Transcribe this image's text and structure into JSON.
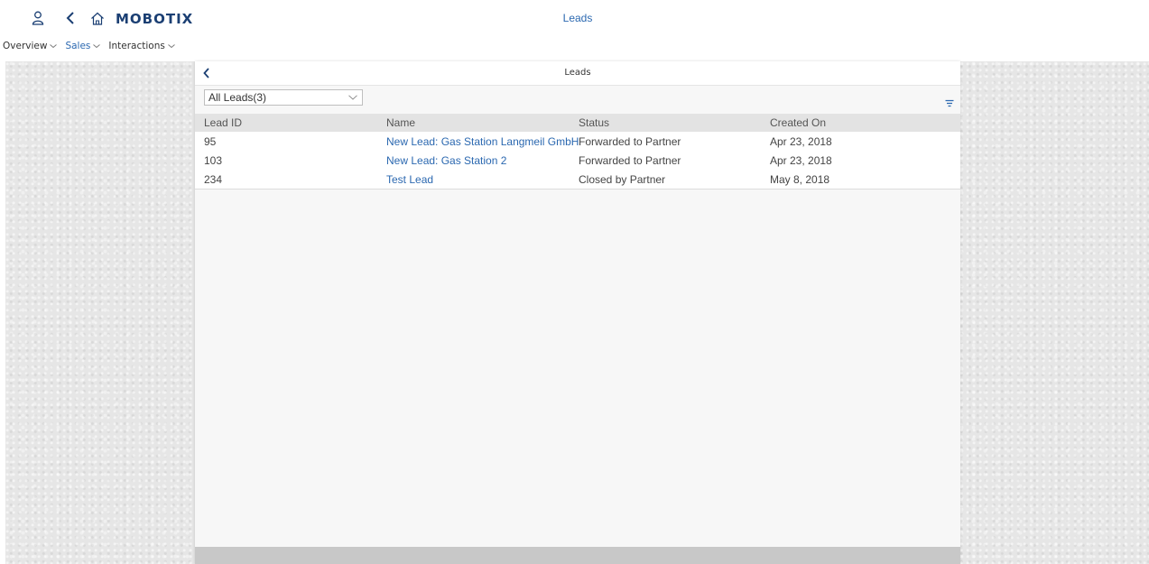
{
  "shell": {
    "brand": "MOBOTIX",
    "title": "Leads"
  },
  "nav": {
    "items": [
      {
        "label": "Overview"
      },
      {
        "label": "Sales"
      },
      {
        "label": "Interactions"
      }
    ],
    "active": "Sales"
  },
  "panel": {
    "title": "Leads",
    "filter_select": {
      "value": "All Leads(3)"
    }
  },
  "table": {
    "columns": [
      "Lead ID",
      "Name",
      "Status",
      "Created On"
    ],
    "rows": [
      {
        "id": "95",
        "name": "New Lead: Gas Station Langmeil GmbH",
        "status": "Forwarded to Partner",
        "created": "Apr 23, 2018"
      },
      {
        "id": "103",
        "name": "New Lead: Gas Station 2",
        "status": "Forwarded to Partner",
        "created": "Apr 23, 2018"
      },
      {
        "id": "234",
        "name": "Test Lead",
        "status": "Closed by Partner",
        "created": "May 8, 2018"
      }
    ]
  },
  "icons": {
    "user": "user-icon",
    "back": "back-icon",
    "home": "home-icon",
    "filter": "filter-icon",
    "dropdown": "chevron-down-icon"
  },
  "colors": {
    "accent": "#2b68b0",
    "brand": "#1b3f73"
  }
}
